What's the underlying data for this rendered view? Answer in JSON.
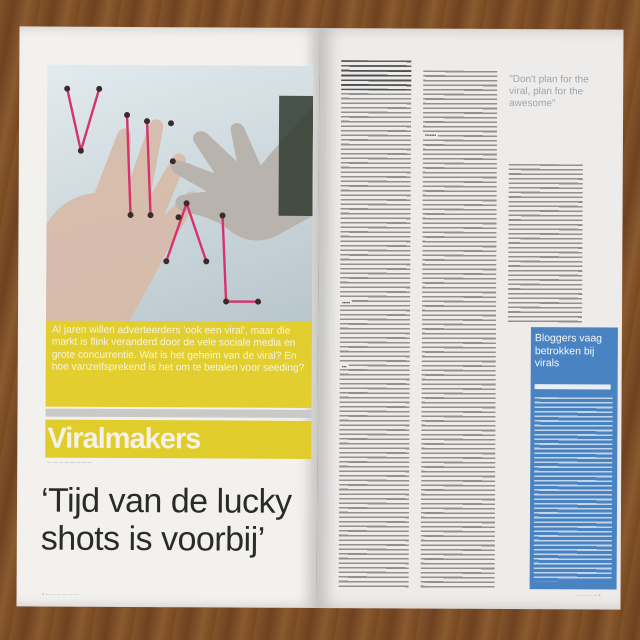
{
  "photo": {
    "word": "VIRAL"
  },
  "intro": {
    "text": "Al jaren willen adverteerders 'ook een viral', maar die markt is flink veranderd door de vele sociale media en grote concurrentie. Wat is het geheim van de viral? En hoe vanzelfsprekend is het om te betalen voor seeding?"
  },
  "section": {
    "title": "Viralmakers"
  },
  "headline": {
    "text": "‘Tijd van de lucky shots is voorbij’"
  },
  "pull_quote": {
    "text": "\"Don't plan for the viral, plan for the awesome\""
  },
  "sidebar_box": {
    "title": "Bloggers vaag betrokken bij virals"
  },
  "colors": {
    "accent_yellow": "#e2cf2f",
    "box_blue": "#4a83c2",
    "magenta_string": "#d6336c"
  }
}
